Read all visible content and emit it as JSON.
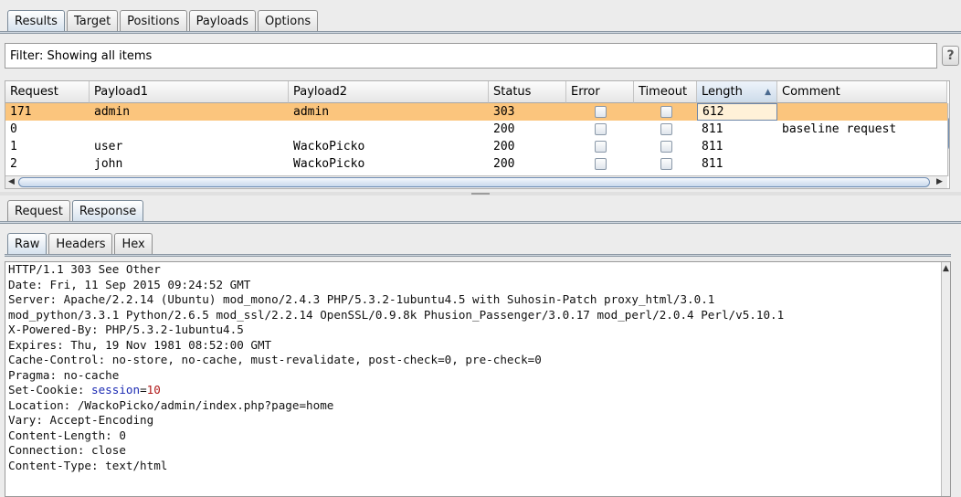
{
  "top_tabs": [
    "Results",
    "Target",
    "Positions",
    "Payloads",
    "Options"
  ],
  "filter_text": "Filter: Showing all items",
  "help_label": "?",
  "columns": [
    "Request",
    "Payload1",
    "Payload2",
    "Status",
    "Error",
    "Timeout",
    "Length",
    "Comment"
  ],
  "sort_indicator": "▲",
  "rows": [
    {
      "request": "171",
      "payload1": "admin",
      "payload2": "admin",
      "status": "303",
      "error": false,
      "timeout": false,
      "length": "612",
      "comment": "",
      "selected": true
    },
    {
      "request": "0",
      "payload1": "",
      "payload2": "",
      "status": "200",
      "error": false,
      "timeout": false,
      "length": "811",
      "comment": "baseline request",
      "selected": false
    },
    {
      "request": "1",
      "payload1": "user",
      "payload2": "WackoPicko",
      "status": "200",
      "error": false,
      "timeout": false,
      "length": "811",
      "comment": "",
      "selected": false
    },
    {
      "request": "2",
      "payload1": "john",
      "payload2": "WackoPicko",
      "status": "200",
      "error": false,
      "timeout": false,
      "length": "811",
      "comment": "",
      "selected": false
    }
  ],
  "detail_tabs": [
    "Request",
    "Response"
  ],
  "view_tabs": [
    "Raw",
    "Headers",
    "Hex"
  ],
  "response_lines": [
    "HTTP/1.1 303 See Other",
    "Date: Fri, 11 Sep 2015 09:24:52 GMT",
    "Server: Apache/2.2.14 (Ubuntu) mod_mono/2.4.3 PHP/5.3.2-1ubuntu4.5 with Suhosin-Patch proxy_html/3.0.1",
    "mod_python/3.3.1 Python/2.6.5 mod_ssl/2.2.14 OpenSSL/0.9.8k Phusion_Passenger/3.0.17 mod_perl/2.0.4 Perl/v5.10.1",
    "X-Powered-By: PHP/5.3.2-1ubuntu4.5",
    "Expires: Thu, 19 Nov 1981 08:52:00 GMT",
    "Cache-Control: no-store, no-cache, must-revalidate, post-check=0, pre-check=0",
    "Pragma: no-cache",
    "Set-Cookie: session=10",
    "Location: /WackoPicko/admin/index.php?page=home",
    "Vary: Accept-Encoding",
    "Content-Length: 0",
    "Connection: close",
    "Content-Type: text/html"
  ],
  "cookie": {
    "prefix": "Set-Cookie: ",
    "name": "session",
    "eq": "=",
    "value": "10"
  },
  "colors": {
    "selected_row": "#fbc57d",
    "cookie_name": "#1c2bb3",
    "cookie_value": "#b01818"
  }
}
